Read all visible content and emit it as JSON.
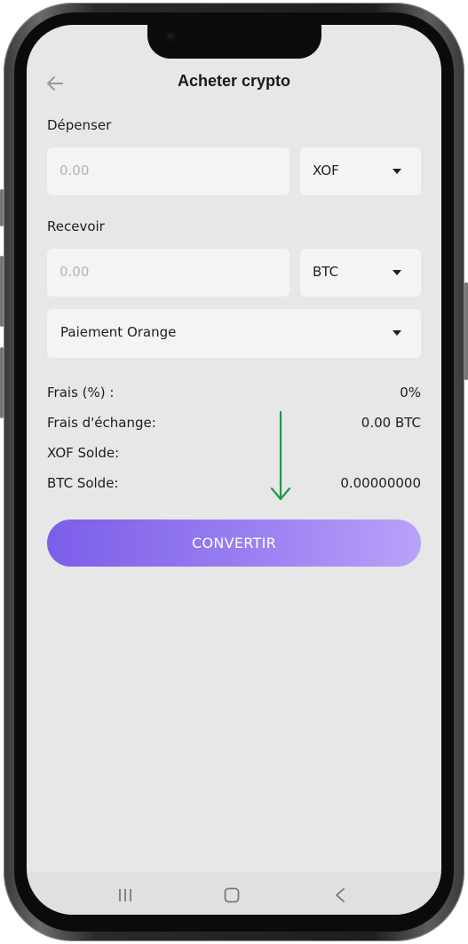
{
  "header": {
    "title": "Acheter crypto",
    "back_icon": "arrow-left-icon"
  },
  "spend": {
    "label": "Dépenser",
    "amount_placeholder": "0.00",
    "currency": "XOF"
  },
  "receive": {
    "label": "Recevoir",
    "amount_placeholder": "0.00",
    "currency": "BTC"
  },
  "payment_method": {
    "selected": "Paiement Orange"
  },
  "info": [
    {
      "key": "Frais (%) :",
      "value": "0%"
    },
    {
      "key": "Frais d'échange:",
      "value": "0.00 BTC"
    },
    {
      "key": "XOF Solde:",
      "value": ""
    },
    {
      "key": "BTC Solde:",
      "value": "0.00000000"
    }
  ],
  "convert_label": "CONVERTIR",
  "colors": {
    "accent_start": "#7b5ee8",
    "accent_end": "#b9a2f8",
    "annotation_arrow": "#1a9a4a",
    "screen_bg": "#e7e7e7",
    "field_bg": "#f4f4f4"
  },
  "navbar": {
    "icons": [
      "recents-icon",
      "home-icon",
      "back-icon"
    ]
  }
}
